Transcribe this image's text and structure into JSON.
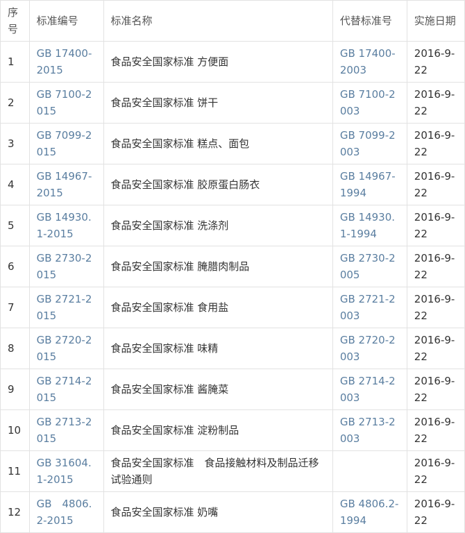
{
  "table": {
    "headers": [
      "序号",
      "标准编号",
      "标准名称",
      "代替标准号",
      "实施日期"
    ],
    "rows": [
      [
        "1",
        "GB 17400-2015",
        "食品安全国家标准 方便面",
        "GB 17400-2003",
        "2016-9-22"
      ],
      [
        "2",
        "GB 7100-2015",
        "食品安全国家标准 饼干",
        "GB 7100-2003",
        "2016-9-22"
      ],
      [
        "3",
        "GB 7099-2015",
        "食品安全国家标准 糕点、面包",
        "GB 7099-2003",
        "2016-9-22"
      ],
      [
        "4",
        "GB 14967-2015",
        "食品安全国家标准 胶原蛋白肠衣",
        "GB 14967-1994",
        "2016-9-22"
      ],
      [
        "5",
        "GB 14930.1-2015",
        "食品安全国家标准 洗涤剂",
        "GB 14930.1-1994",
        "2016-9-22"
      ],
      [
        "6",
        "GB 2730-2015",
        "食品安全国家标准 腌腊肉制品",
        "GB 2730-2005",
        "2016-9-22"
      ],
      [
        "7",
        "GB 2721-2015",
        "食品安全国家标准 食用盐",
        "GB 2721-2003",
        "2016-9-22"
      ],
      [
        "8",
        "GB 2720-2015",
        "食品安全国家标准 味精",
        "GB 2720-2003",
        "2016-9-22"
      ],
      [
        "9",
        "GB 2714-2015",
        "食品安全国家标准 酱腌菜",
        "GB 2714-2003",
        "2016-9-22"
      ],
      [
        "10",
        "GB 2713-2015",
        "食品安全国家标准 淀粉制品",
        "GB 2713-2003",
        "2016-9-22"
      ],
      [
        "11",
        "GB 31604.1-2015",
        "食品安全国家标准　食品接触材料及制品迁移试验通则",
        "",
        "2016-9-22"
      ],
      [
        "12",
        "GB　4806.2-2015",
        "食品安全国家标准 奶嘴",
        "GB 4806.2-1994",
        "2016-9-22"
      ]
    ]
  }
}
